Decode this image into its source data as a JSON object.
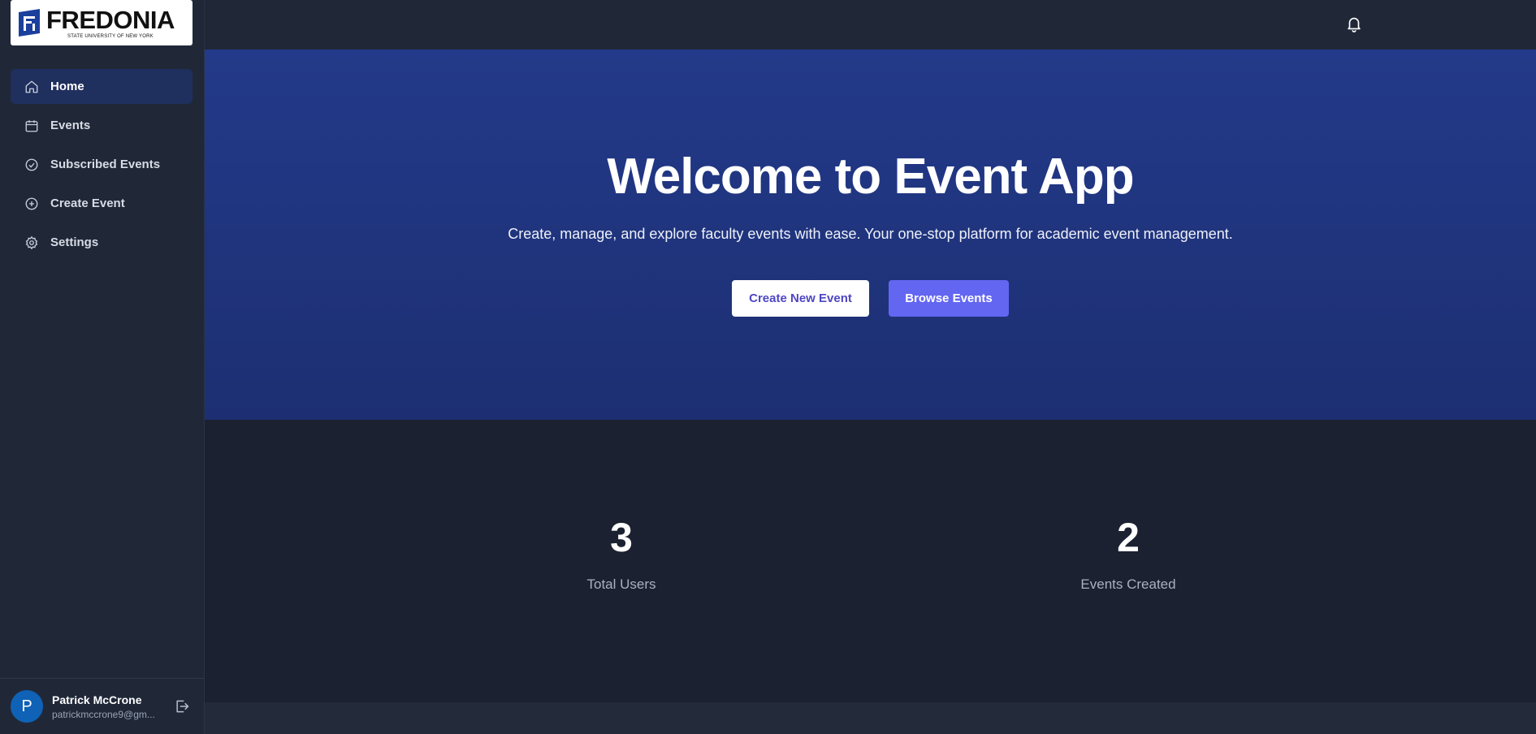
{
  "brand": {
    "wordmark": "FREDONIA",
    "subtitle": "STATE UNIVERSITY OF NEW YORK",
    "color": "#1b3f9c"
  },
  "sidebar": {
    "items": [
      {
        "label": "Home",
        "icon": "home-icon",
        "active": true
      },
      {
        "label": "Events",
        "icon": "calendar-icon",
        "active": false
      },
      {
        "label": "Subscribed Events",
        "icon": "check-circle-icon",
        "active": false
      },
      {
        "label": "Create Event",
        "icon": "plus-circle-icon",
        "active": false
      },
      {
        "label": "Settings",
        "icon": "gear-icon",
        "active": false
      }
    ]
  },
  "user": {
    "initial": "P",
    "name": "Patrick McCrone",
    "email": "patrickmccrone9@gm..."
  },
  "hero": {
    "title": "Welcome to Event App",
    "subtitle": "Create, manage, and explore faculty events with ease. Your one-stop platform for academic event management.",
    "primary_button": "Create New Event",
    "secondary_button": "Browse Events"
  },
  "stats": [
    {
      "value": "3",
      "label": "Total Users"
    },
    {
      "value": "2",
      "label": "Events Created"
    }
  ],
  "colors": {
    "accent": "#6366f1",
    "active_nav": "#1f2f5e",
    "hero": "#233a8a"
  }
}
